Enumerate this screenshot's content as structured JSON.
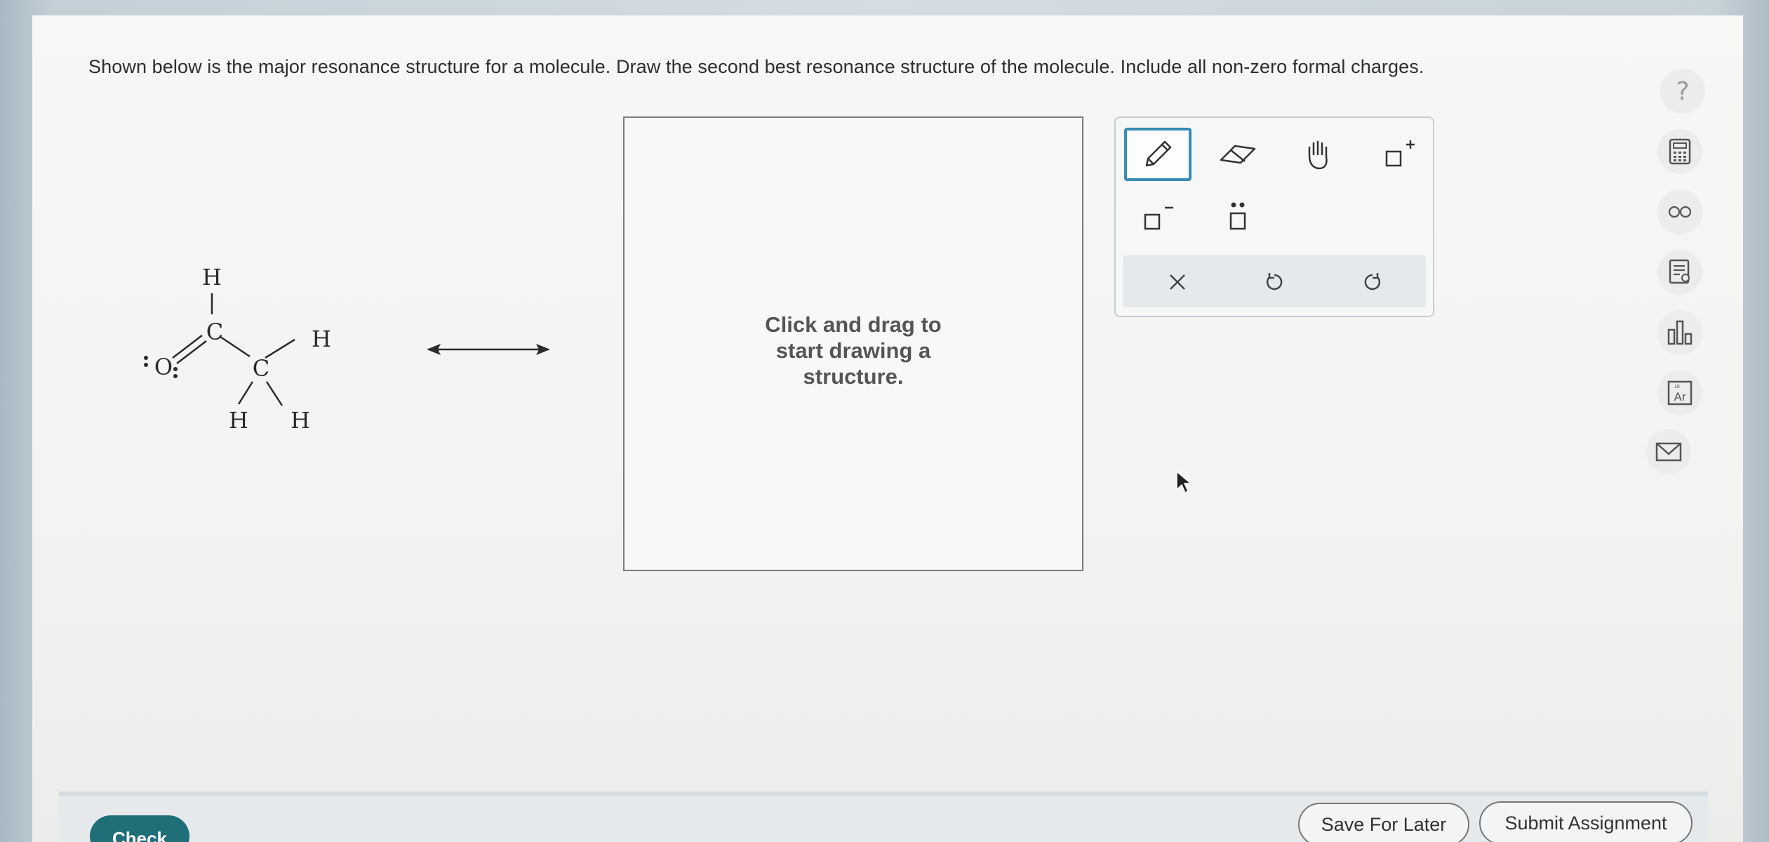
{
  "question": {
    "text": "Shown below is the major resonance structure for a molecule. Draw the second best resonance structure of the molecule. Include all non-zero formal charges."
  },
  "molecule": {
    "atoms": {
      "h_top": "H",
      "c1": "C",
      "o": "O",
      "c2": "C",
      "h_right": "H",
      "h_left_bottom": "H",
      "h_right_bottom": "H"
    }
  },
  "canvas": {
    "hint_lines": [
      "Click and drag to",
      "start drawing a",
      "structure."
    ]
  },
  "toolbar": {
    "tools": [
      "pencil-icon",
      "eraser-icon",
      "hand-icon",
      "positive-charge-icon",
      "negative-charge-icon",
      "lone-pair-icon"
    ],
    "actions": [
      "clear-icon",
      "undo-icon",
      "redo-icon"
    ],
    "accent_color": "#3a8bb3"
  },
  "sidebar": {
    "help_label": "?",
    "icons": [
      "calculator-icon",
      "glasses-icon",
      "notes-icon",
      "bar-chart-icon",
      "periodic-table-icon",
      "mail-icon"
    ],
    "periodic_label": "Ar"
  },
  "footer": {
    "check_label": "Check",
    "save_label": "Save For Later",
    "submit_label": "Submit Assignment",
    "check_color": "#1f6f79"
  }
}
